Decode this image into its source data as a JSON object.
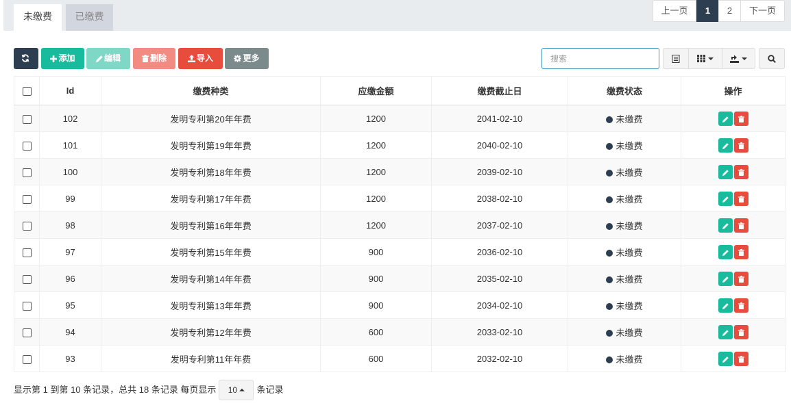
{
  "tabs": [
    {
      "label": "未缴费",
      "active": true
    },
    {
      "label": "已缴费",
      "active": false
    }
  ],
  "toolbar": {
    "refresh_icon": "refresh-icon",
    "add_label": "添加",
    "edit_label": "编辑",
    "delete_label": "删除",
    "import_label": "导入",
    "more_label": "更多"
  },
  "search": {
    "placeholder": "搜索",
    "value": ""
  },
  "table": {
    "columns": [
      "Id",
      "缴费种类",
      "应缴金额",
      "缴费截止日",
      "缴费状态",
      "操作"
    ],
    "rows": [
      {
        "id": "102",
        "type": "发明专利第20年年费",
        "amount": "1200",
        "deadline": "2041-02-10",
        "status": "未缴费"
      },
      {
        "id": "101",
        "type": "发明专利第19年年费",
        "amount": "1200",
        "deadline": "2040-02-10",
        "status": "未缴费"
      },
      {
        "id": "100",
        "type": "发明专利第18年年费",
        "amount": "1200",
        "deadline": "2039-02-10",
        "status": "未缴费"
      },
      {
        "id": "99",
        "type": "发明专利第17年年费",
        "amount": "1200",
        "deadline": "2038-02-10",
        "status": "未缴费"
      },
      {
        "id": "98",
        "type": "发明专利第16年年费",
        "amount": "1200",
        "deadline": "2037-02-10",
        "status": "未缴费"
      },
      {
        "id": "97",
        "type": "发明专利第15年年费",
        "amount": "900",
        "deadline": "2036-02-10",
        "status": "未缴费"
      },
      {
        "id": "96",
        "type": "发明专利第14年年费",
        "amount": "900",
        "deadline": "2035-02-10",
        "status": "未缴费"
      },
      {
        "id": "95",
        "type": "发明专利第13年年费",
        "amount": "900",
        "deadline": "2034-02-10",
        "status": "未缴费"
      },
      {
        "id": "94",
        "type": "发明专利第12年年费",
        "amount": "600",
        "deadline": "2033-02-10",
        "status": "未缴费"
      },
      {
        "id": "93",
        "type": "发明专利第11年年费",
        "amount": "600",
        "deadline": "2032-02-10",
        "status": "未缴费"
      }
    ]
  },
  "pager": {
    "summary": "显示第 1 到第 10 条记录，总共 18 条记录 每页显示",
    "page_size": "10",
    "suffix": "条记录",
    "prev": "上一页",
    "pages": [
      "1",
      "2"
    ],
    "current": "1",
    "next": "下一页"
  },
  "colors": {
    "primary": "#2c3e50",
    "success": "#18bc9c",
    "danger": "#e74c3c",
    "muted": "#7b8a8b"
  }
}
